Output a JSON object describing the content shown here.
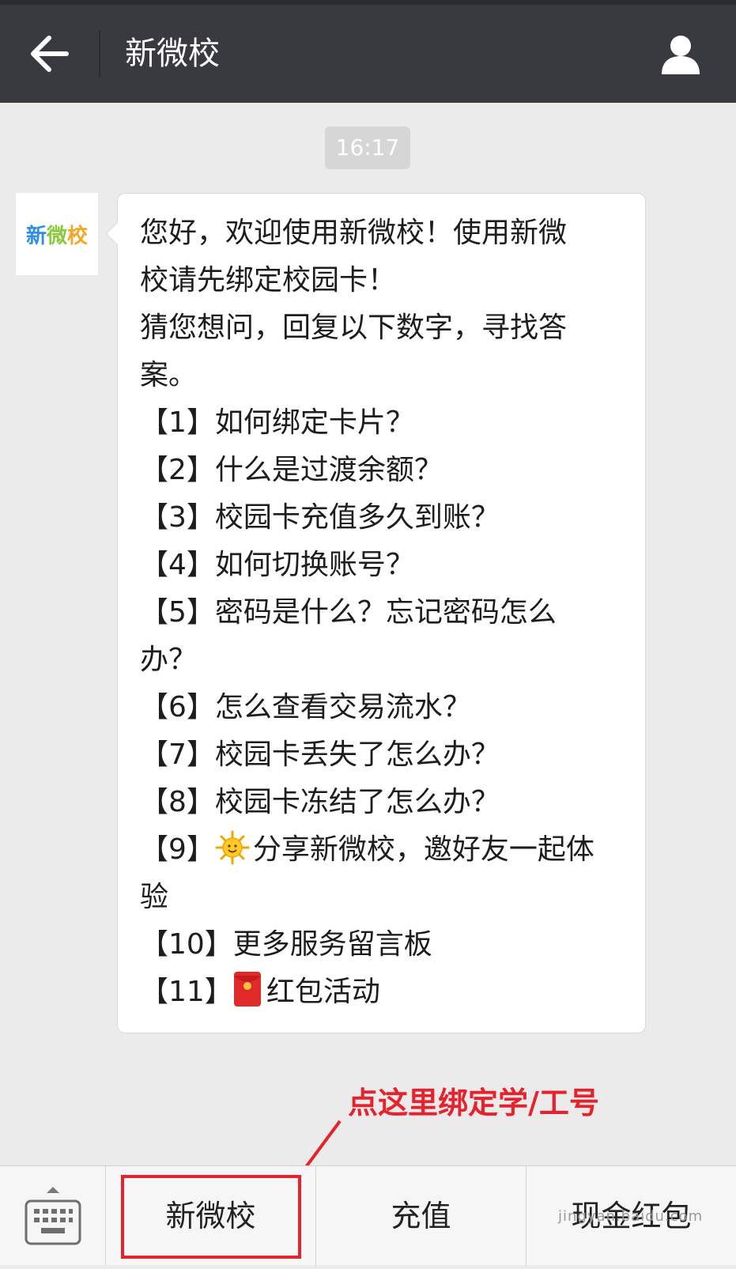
{
  "header": {
    "back_icon": "arrow-left-icon",
    "title": "新微校",
    "profile_icon": "person-icon"
  },
  "chat": {
    "timestamp": "16:17",
    "avatar": {
      "logo_text": "新微校"
    },
    "message_lines": [
      "您好，欢迎使用新微校！使用新微",
      "校请先绑定校园卡！",
      "猜您想问，回复以下数字，寻找答",
      "案。",
      "【1】如何绑定卡片？",
      "【2】什么是过渡余额？",
      "【3】校园卡充值多久到账？",
      "【4】如何切换账号？",
      "【5】密码是什么？忘记密码怎么",
      "办？",
      "【6】怎么查看交易流水？",
      "【7】校园卡丢失了怎么办？",
      "【8】校园卡冻结了怎么办？",
      "【9】",
      "分享新微校，邀好友一起体",
      "验",
      "【10】更多服务留言板",
      "【11】",
      "红包活动"
    ]
  },
  "annotation": {
    "label": "点这里绑定学/工号",
    "color": "#e8222c"
  },
  "menu": {
    "keyboard_icon": "keyboard-icon",
    "items": [
      "新微校",
      "充值",
      "现金红包"
    ]
  },
  "watermark": "jingyan.baidu.com",
  "colors": {
    "topbar": "#393a3f",
    "background": "#ebebeb",
    "annotation": "#e8222c"
  }
}
